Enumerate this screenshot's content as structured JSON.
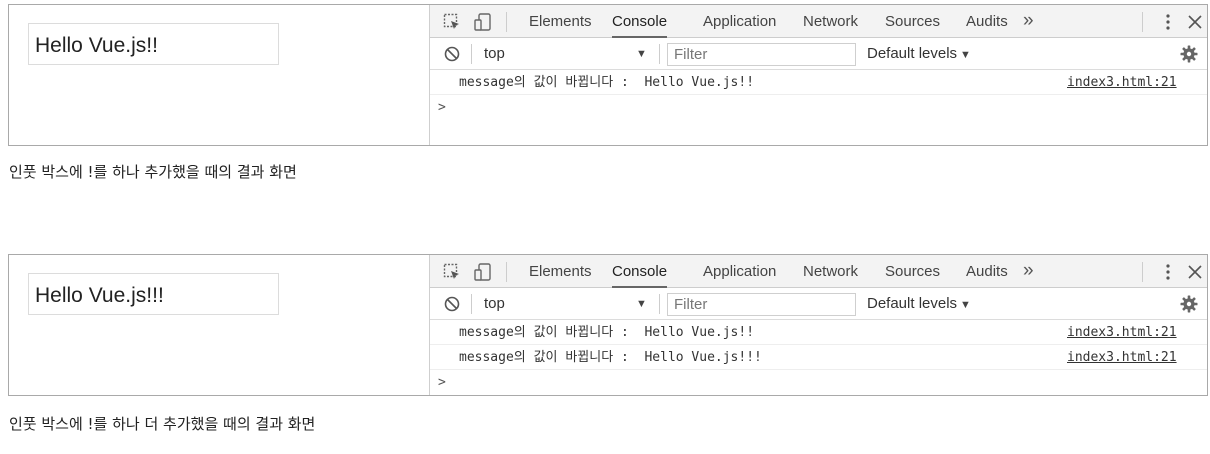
{
  "devtools": {
    "tabs": [
      "Elements",
      "Console",
      "Application",
      "Network",
      "Sources",
      "Audits"
    ],
    "active_tab": "Console",
    "more_tabs": "»",
    "context": "top",
    "filter_placeholder": "Filter",
    "levels": "Default levels",
    "prompt": ">"
  },
  "panels": [
    {
      "input_value": "Hello Vue.js!!",
      "logs": [
        {
          "message": "message의 값이 바뀝니다 :  Hello Vue.js!!",
          "source": "index3.html:21"
        }
      ],
      "caption": "인풋 박스에 !를 하나 추가했을 때의 결과 화면"
    },
    {
      "input_value": "Hello Vue.js!!!",
      "logs": [
        {
          "message": "message의 값이 바뀝니다 :  Hello Vue.js!!",
          "source": "index3.html:21"
        },
        {
          "message": "message의 값이 바뀝니다 :  Hello Vue.js!!!",
          "source": "index3.html:21"
        }
      ],
      "caption": "인풋 박스에 !를 하나 더 추가했을 때의 결과 화면"
    }
  ]
}
